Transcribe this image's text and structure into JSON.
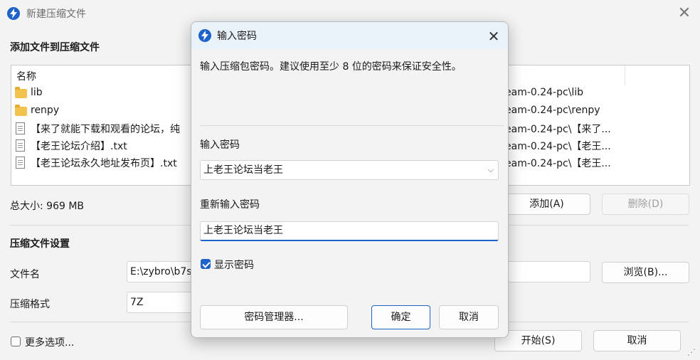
{
  "main": {
    "title": "新建压缩文件",
    "close_glyph": "✕",
    "add_section_title": "添加文件到压缩文件",
    "column_name": "名称",
    "files": [
      {
        "name": "lib",
        "path": "eam-0.24-pc\\lib",
        "icon": "folder-icon"
      },
      {
        "name": "renpy",
        "path": "eam-0.24-pc\\renpy",
        "icon": "folder-icon"
      },
      {
        "name": "【来了就能下载和观看的论坛，纯",
        "path": "eam-0.24-pc\\【来了...",
        "icon": "doc-icon"
      },
      {
        "name": "【老王论坛介绍】.txt",
        "path": "eam-0.24-pc\\【老王...",
        "icon": "doc-icon"
      },
      {
        "name": "【老王论坛永久地址发布页】.txt",
        "path": "eam-0.24-pc\\【老王...",
        "icon": "doc-icon"
      }
    ],
    "total_size": "总大小: 969 MB",
    "add_button": "添加(A)",
    "delete_button": "删除(D)",
    "settings_title": "压缩文件设置",
    "filename_label": "文件名",
    "filename_value": "E:\\zybro\\b7s",
    "browse_button": "浏览(B)...",
    "format_label": "压缩格式",
    "format_value": "7Z",
    "more_options": "更多选项...",
    "start_button": "开始(S)",
    "cancel_button": "取消"
  },
  "dialog": {
    "title": "输入密码",
    "close_glyph": "✕",
    "description": "输入压缩包密码。建议使用至少 8 位的密码来保证安全性。",
    "password_label": "输入密码",
    "password_value": "上老王论坛当老王",
    "reenter_label": "重新输入密码",
    "reenter_value": "上老王论坛当老王",
    "show_password": "显示密码",
    "show_password_checked": true,
    "manager_button": "密码管理器...",
    "ok_button": "确定",
    "cancel_button": "取消"
  },
  "colors": {
    "accent": "#1e63c9",
    "folder": "#f2c34d"
  }
}
